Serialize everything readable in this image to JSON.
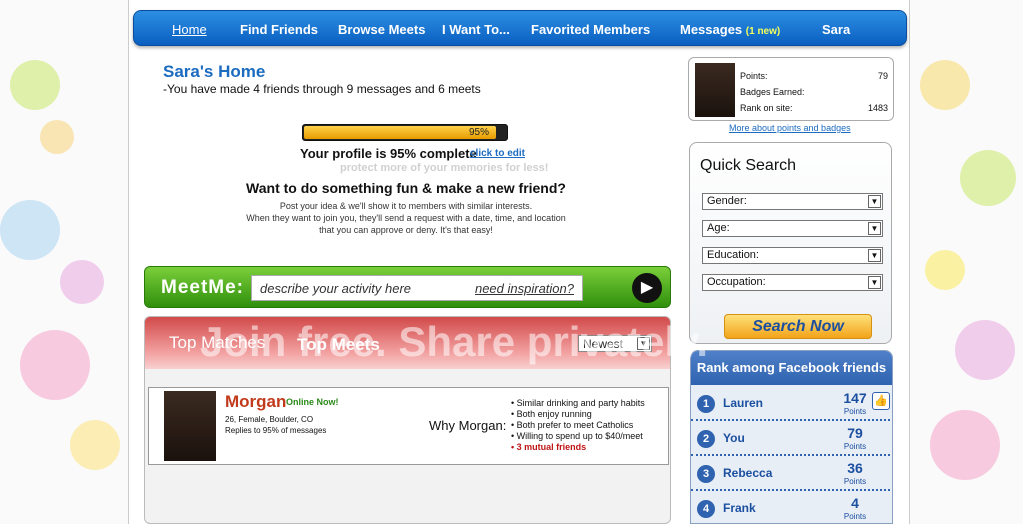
{
  "nav": {
    "items": [
      "Home",
      "Find Friends",
      "Browse Meets",
      "I Want To...",
      "Favorited Members",
      "Messages",
      "Sara"
    ],
    "messages_new": "(1 new)"
  },
  "home": {
    "title": "Sara's Home",
    "subtitle": "-You have made 4 friends through 9 messages and 6 meets"
  },
  "profile": {
    "percent_label": "95%",
    "percent_value": 95,
    "status": "Your profile is 95% complete",
    "edit_link": "click to edit"
  },
  "fun": {
    "title": "Want to do something fun & make a new friend?",
    "lines": [
      "Post your idea & we'll show it to members with similar interests.",
      "When they want to join you, they'll send a request with a date, time, and location",
      "that you can approve or deny.  It's that easy!"
    ]
  },
  "meetme": {
    "label": "MeetMe:",
    "placeholder": "describe your activity here",
    "inspiration": "need inspiration?"
  },
  "matches": {
    "tabs": [
      "Top Matches",
      "Top Meets"
    ],
    "sort": "Newest",
    "card": {
      "name": "Morgan",
      "online": "Online Now!",
      "details": "26, Female, Boulder, CO",
      "reply": "Replies to 95% of messages",
      "why_label": "Why Morgan:",
      "reasons": [
        "Similar drinking and party habits",
        "Both enjoy running",
        "Both prefer to meet Catholics",
        "Willing to spend up to $40/meet",
        "3 mutual friends"
      ]
    }
  },
  "points": {
    "rows": [
      {
        "label": "Points:",
        "value": "79"
      },
      {
        "label": "Badges Earned:",
        "value": ""
      },
      {
        "label": "Rank on site:",
        "value": "1483"
      }
    ],
    "link": "More about points and badges"
  },
  "quick_search": {
    "title": "Quick Search",
    "fields": [
      "Gender:",
      "Age:",
      "Education:",
      "Occupation:"
    ],
    "button": "Search Now"
  },
  "rank": {
    "title": "Rank among Facebook friends",
    "points_label": "Points",
    "rows": [
      {
        "num": "1",
        "name": "Lauren",
        "points": "147"
      },
      {
        "num": "2",
        "name": "You",
        "points": "79"
      },
      {
        "num": "3",
        "name": "Rebecca",
        "points": "36"
      },
      {
        "num": "4",
        "name": "Frank",
        "points": "4"
      }
    ]
  },
  "watermark": {
    "top": "protect more of your memories for less!",
    "bottom": "Join free. Share privately."
  },
  "colors": {
    "nav": "#0a5fc0",
    "accent_green": "#2f8f0c",
    "accent_red": "#d24a4a",
    "rank_blue": "#2f63b0"
  }
}
